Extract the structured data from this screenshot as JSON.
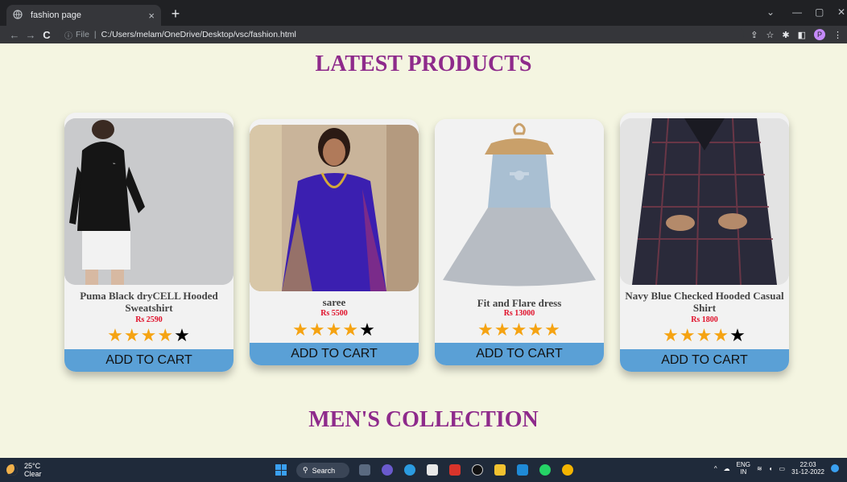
{
  "browser": {
    "tab_title": "fashion page",
    "tab_close": "×",
    "new_tab": "+",
    "url_scheme": "File",
    "url": "C:/Users/melam/OneDrive/Desktop/vsc/fashion.html",
    "profile_initial": "P"
  },
  "page": {
    "latest_title": "LATEST PRODUCTS",
    "mens_title": "MEN'S COLLECTION",
    "products": [
      {
        "name": "Puma Black dryCELL Hooded Sweatshirt",
        "price": "Rs 2590",
        "rating": 4,
        "cart_label": "ADD TO CART"
      },
      {
        "name": "saree",
        "price": "Rs 5500",
        "rating": 4,
        "cart_label": "ADD TO CART"
      },
      {
        "name": "Fit and Flare dress",
        "price": "Rs 13000",
        "rating": 5,
        "cart_label": "ADD TO CART"
      },
      {
        "name": "Navy Blue Checked Hooded Casual Shirt",
        "price": "Rs 1800",
        "rating": 4,
        "cart_label": "ADD TO CART"
      }
    ]
  },
  "taskbar": {
    "temperature": "25°C",
    "weather": "Clear",
    "search_label": "Search",
    "lang_top": "ENG",
    "lang_bottom": "IN",
    "time": "22:03",
    "date": "31-12-2022"
  },
  "colors": {
    "page_bg": "#f4f5e1",
    "title": "#8e2a8b",
    "price": "#e0102a",
    "cart_button": "#5aa0d6",
    "star": "#f5a312"
  }
}
